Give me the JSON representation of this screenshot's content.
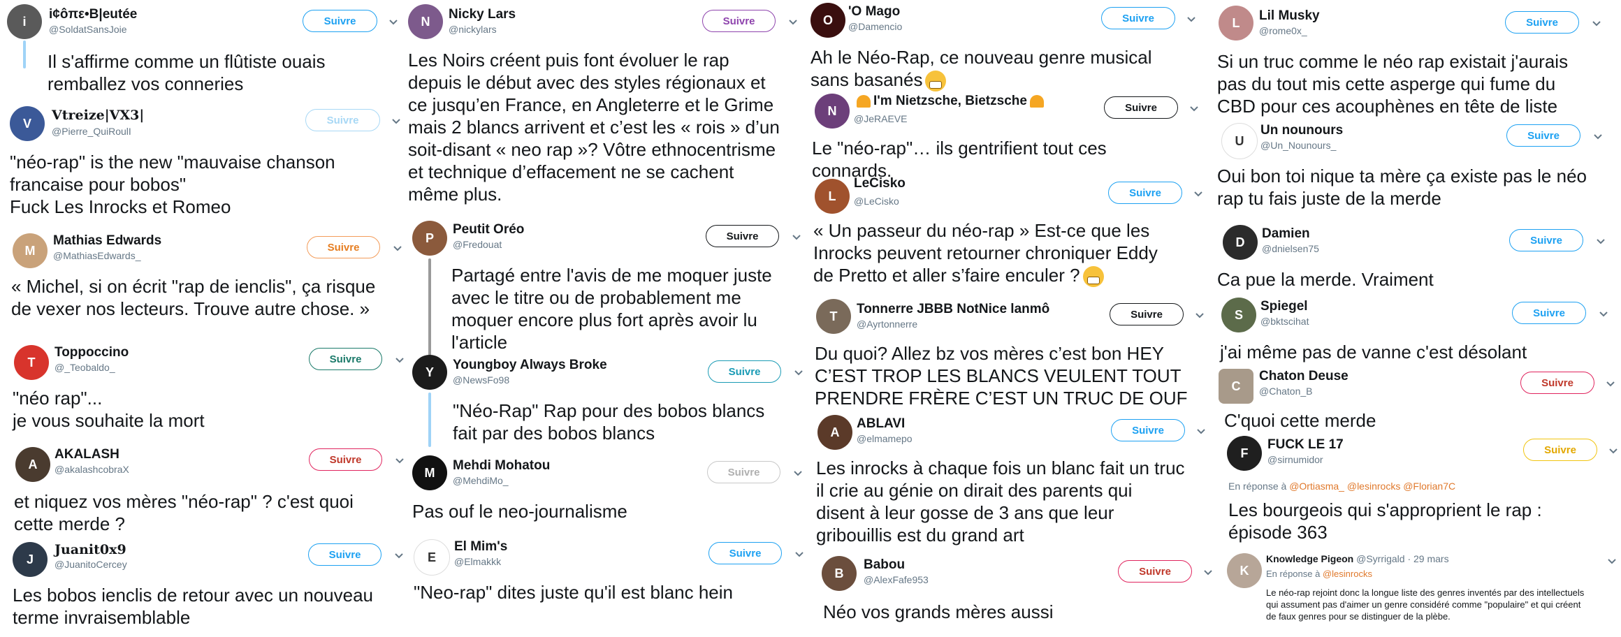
{
  "col1": {
    "t1": {
      "name": "i¢ôπε•B|eutée",
      "handle": "@SoldatSansJoie",
      "follow": "Suivre",
      "text": "Il s'affirme comme un flûtiste ouais\nremballez vos conneries"
    },
    "t2": {
      "name": "Vtreize|VX3|",
      "handle": "@Pierre_QuiRoulI",
      "follow": "Suivre",
      "text": "\"néo-rap\" is the new \"mauvaise chanson\nfrancaise pour bobos\"\nFuck Les Inrocks et Romeo"
    },
    "t3": {
      "name": "Mathias Edwards",
      "handle": "@MathiasEdwards_",
      "follow": "Suivre",
      "text": "« Michel, si on écrit \"rap de ienclis\", ça risque\nde vexer nos lecteurs. Trouve autre chose. »"
    },
    "t4": {
      "name": "Toppoccino",
      "handle": "@_Teobaldo_",
      "follow": "Suivre",
      "text": "\"néo rap\"...\nje vous souhaite la mort"
    },
    "t5": {
      "name": "AKALASH",
      "handle": "@akalashcobraX",
      "follow": "Suivre",
      "text": "et niquez vos mères \"néo-rap\" ? c'est quoi\ncette merde ?"
    },
    "t6": {
      "name": "Juanit0x9",
      "handle": "@JuanitoCercey",
      "follow": "Suivre",
      "text": "Les bobos ienclis de retour avec un nouveau\nterme invraisemblable"
    }
  },
  "col2": {
    "t1": {
      "name": "Nicky Lars",
      "handle": "@nickylars",
      "follow": "Suivre",
      "text": "Les Noirs créent puis font évoluer le rap\ndepuis le début avec des styles régionaux et\nce jusqu’en France, en Angleterre et le Grime\nmais 2 blancs arrivent et c’est les « rois » d’un\nsoit-disant « neo rap »? Vôtre ethnocentrisme\net technique d’effacement ne se cachent\nmême plus."
    },
    "t2": {
      "name": "Peutit Oréo",
      "handle": "@Fredouat",
      "follow": "Suivre",
      "text": "Partagé entre l'avis de me moquer juste\navec le titre ou de probablement me\nmoquer encore plus fort après avoir lu\nl'article"
    },
    "t3": {
      "name": "Youngboy Always Broke",
      "handle": "@NewsFo98",
      "follow": "Suivre",
      "text": "\"Néo-Rap\" Rap pour des bobos blancs\nfait par des bobos blancs"
    },
    "t4": {
      "name": "Mehdi Mohatou",
      "handle": "@MehdiMo_",
      "follow": "Suivre",
      "text": "Pas ouf le neo-journalisme"
    },
    "t5": {
      "name": "El Mim's",
      "handle": "@Elmakkk",
      "follow": "Suivre",
      "text": "\"Neo-rap\" dites juste qu'il est blanc hein"
    }
  },
  "col3": {
    "t1": {
      "name": "'O Mago",
      "handle": "@Damencio",
      "follow": "Suivre",
      "text": "Ah le Néo-Rap, ce nouveau genre musical\nsans basanés"
    },
    "t2": {
      "name": "I'm Nietzsche, Bietzsche",
      "handle": "@JeRAEVE",
      "follow": "Suivre",
      "text": "Le \"néo-rap\"… ils gentrifient tout ces\nconnards."
    },
    "t3": {
      "name": "LeCisko",
      "handle": "@LeCisko",
      "follow": "Suivre",
      "text": "« Un passeur du néo-rap » Est-ce que les\nInrocks peuvent retourner chroniquer Eddy\nde Pretto et aller s’faire enculer ?"
    },
    "t4": {
      "name": "Tonnerre JBBB NotNice lanmô",
      "handle": "@Ayrtonnerre",
      "follow": "Suivre",
      "text": "Du quoi? Allez bz vos mères c’est bon HEY\nC’EST TROP LES BLANCS VEULENT TOUT\nPRENDRE FRÈRE C’EST UN TRUC DE OUF"
    },
    "t5": {
      "name": "ABLAVI",
      "handle": "@elmamepo",
      "follow": "Suivre",
      "text": "Les inrocks à chaque fois un blanc fait un truc\nil crie au génie on dirait des parents qui\ndisent à leur gosse de 3 ans que leur\ngribouillis est du grand art"
    },
    "t6": {
      "name": "Babou",
      "handle": "@AlexFafe953",
      "follow": "Suivre",
      "text": "Néo vos grands mères aussi"
    }
  },
  "col4": {
    "t1": {
      "name": "Lil Musky",
      "handle": "@rome0x_",
      "follow": "Suivre",
      "text": "Si un truc comme le néo rap existait j'aurais\npas du tout mis cette asperge qui fume du\nCBD pour ces acouphènes en tête de liste"
    },
    "t2": {
      "name": "Un nounours",
      "handle": "@Un_Nounours_",
      "follow": "Suivre",
      "text": "Oui bon toi nique ta mère ça existe pas le néo\nrap tu fais juste de la merde"
    },
    "t3": {
      "name": "Damien",
      "handle": "@dnielsen75",
      "follow": "Suivre",
      "text": "Ca pue la merde. Vraiment"
    },
    "t4": {
      "name": "Spiegel",
      "handle": "@bktscihat",
      "follow": "Suivre",
      "text": "j'ai même pas de vanne c'est désolant"
    },
    "t5": {
      "name": "Chaton Deuse",
      "handle": "@Chaton_B",
      "follow": "Suivre",
      "text": "C'quoi cette merde"
    },
    "t6": {
      "name": "FUCK LE 17",
      "handle": "@sirnumidor",
      "follow": "Suivre",
      "reply_prefix": "En réponse à",
      "reply_mentions": "@Ortiasma_ @lesinrocks @Florian7C",
      "text": "Les bourgeois qui s'approprient le rap :\népisode 363"
    },
    "t7": {
      "name": "Knowledge Pigeon",
      "handle": "@Syrrigald",
      "date": "· 29 mars",
      "reply_prefix": "En réponse à",
      "reply_mentions": "@lesinrocks",
      "text": "Le néo-rap rejoint donc la longue liste des genres inventés par des intellectuels\nqui assument pas d'aimer un genre considéré comme \"populaire\" et qui créent\nde faux genres pour se distinguer de la plèbe."
    }
  },
  "colors": {
    "twitter_blue": "#1da1f2",
    "text": "#14171a",
    "muted": "#657786"
  }
}
